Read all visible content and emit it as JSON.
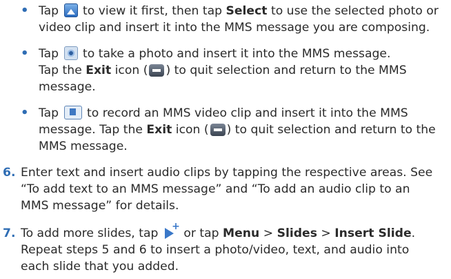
{
  "bullets": [
    {
      "lines": [
        {
          "t1": "Tap ",
          "icon": "view-photo-icon",
          "t2": " to view it first, then tap ",
          "bold": "Select",
          "t3": " to use the selected photo or"
        },
        {
          "t1": "video clip and insert it into the MMS message you are composing."
        }
      ]
    },
    {
      "lines": [
        {
          "t1": "Tap ",
          "icon": "camera-icon",
          "t2": " to take a photo and insert it into the MMS message."
        },
        {
          "t1": "Tap the ",
          "bold": "Exit",
          "t2": " icon (",
          "icon": "exit-icon",
          "t3": ") to quit selection and return to the MMS"
        },
        {
          "t1": "message."
        }
      ]
    },
    {
      "lines": [
        {
          "t1": "Tap ",
          "icon": "video-camera-icon",
          "t2": " to record an MMS video clip and insert it into the MMS"
        },
        {
          "t1": "message. Tap the ",
          "bold": "Exit",
          "t2": " icon (",
          "icon": "exit-icon",
          "t3": ") to quit selection and return to the"
        },
        {
          "t1": "MMS message."
        }
      ]
    }
  ],
  "steps": [
    {
      "number": "6.",
      "lines": [
        {
          "t1": "Enter text and insert audio clips by tapping the respective areas. See"
        },
        {
          "t1": "“To add text to an MMS message” and “To add an audio clip to an"
        },
        {
          "t1": "MMS message” for details."
        }
      ]
    },
    {
      "number": "7.",
      "lines": [
        {
          "t1": "To add more slides, tap ",
          "icon": "add-slide-icon",
          "t2": " or tap ",
          "b1": "Menu",
          "t3": " > ",
          "b2": "Slides",
          "t4": " > ",
          "b3": "Insert Slide",
          "t5": "."
        },
        {
          "t1": "Repeat steps 5 and 6 to insert a photo/video, text, and audio into"
        },
        {
          "t1": "each slide that you added."
        }
      ]
    }
  ]
}
